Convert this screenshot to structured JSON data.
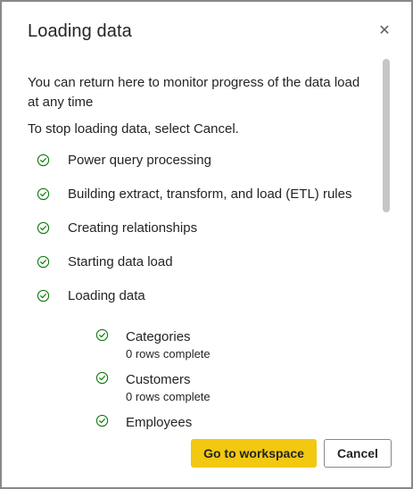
{
  "dialog": {
    "title": "Loading data",
    "close_icon": "close-icon",
    "intro": "You can return here to monitor progress of the data load at any time",
    "stop_text": "To stop loading data, select Cancel.",
    "steps": [
      {
        "label": "Power query processing",
        "icon": "check-circle-icon"
      },
      {
        "label": "Building extract, transform, and load (ETL) rules",
        "icon": "check-circle-icon"
      },
      {
        "label": "Creating relationships",
        "icon": "check-circle-icon"
      },
      {
        "label": "Starting data load",
        "icon": "check-circle-icon"
      },
      {
        "label": "Loading data",
        "icon": "check-circle-icon"
      }
    ],
    "tables": [
      {
        "name": "Categories",
        "status": "0 rows complete",
        "icon": "check-circle-icon"
      },
      {
        "name": "Customers",
        "status": "0 rows complete",
        "icon": "check-circle-icon"
      },
      {
        "name": "Employees",
        "status": "",
        "icon": "check-circle-icon"
      }
    ],
    "primary_button": "Go to workspace",
    "secondary_button": "Cancel"
  },
  "colors": {
    "accent": "#f2c811",
    "check": "#107c10",
    "text": "#252423",
    "border": "#8a8886"
  }
}
